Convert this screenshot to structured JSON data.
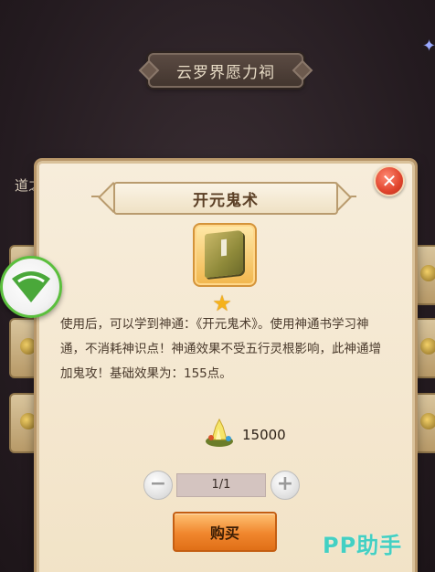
{
  "header": {
    "plaque_title": "云罗界愿力祠",
    "side_text": "道之"
  },
  "dialog": {
    "title": "开元鬼术",
    "close_symbol": "✕",
    "item_icon": "book-icon",
    "rarity_star": "★",
    "description": "使用后，可以学到神通：《开元鬼术》。使用神通书学习神通，不消耗神识点！神通效果不受五行灵根影响，此神通增加鬼攻！基础效果为：155点。",
    "price": "15000",
    "price_icon": "spirit-stone-icon",
    "quantity": "1/1",
    "minus_symbol": "−",
    "plus_symbol": "+",
    "buy_label": "购买"
  },
  "overlay": {
    "float_button_icon": "wifi-icon",
    "watermark": "PP助手"
  },
  "colors": {
    "dialog_bg": "#f7eddb",
    "buy_button": "#f0862d",
    "close_button": "#e0432c",
    "float_border": "#5bbf3d",
    "watermark": "#43d0c3"
  }
}
